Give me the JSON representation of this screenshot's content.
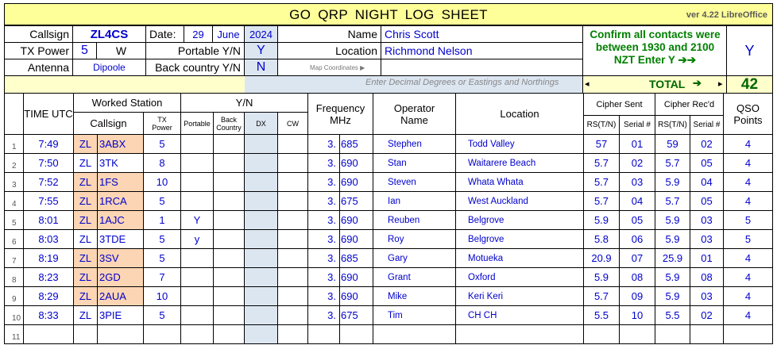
{
  "title": "GO  QRP  NIGHT  LOG  SHEET",
  "version": "ver 4.22 LibreOffice",
  "header": {
    "callsign_label": "Callsign",
    "callsign": "ZL4CS",
    "date_label": "Date:",
    "day": "29",
    "month": "June",
    "year": "2024",
    "name_label": "Name",
    "name": "Chris Scott",
    "tx_power_label": "TX Power",
    "tx_power": "5",
    "tx_power_unit": "W",
    "portable_label": "Portable Y/N",
    "portable": "Y",
    "location_label": "Location",
    "location": "Richmond Nelson",
    "antenna_label": "Antenna",
    "antenna": "Dipoole",
    "back_country_label": "Back country Y/N",
    "back_country": "N",
    "map_coords_label": "Map Coordinates ▶",
    "coords_hint": "Enter  Decimal Degrees or Eastings and Northings",
    "confirm_line1": "Confirm all contacts were",
    "confirm_line2": "between 1930 and 2100",
    "confirm_line3": "NZT    Enter   Y    ➔➔",
    "confirm_value": "Y",
    "total_label": "TOTAL",
    "total_arrow": "➔",
    "total_value": "42",
    "left_marker": "◂",
    "right_marker": "▸"
  },
  "columns": {
    "time_utc": "TIME UTC",
    "worked_station": "Worked Station",
    "callsign": "Callsign",
    "tx_power": "TX Power",
    "yn": "Y/N",
    "portable": "Portable",
    "back_country": "Back Country",
    "dx": "DX",
    "cw": "CW",
    "frequency": "Frequency MHz",
    "operator_name": "Operator Name",
    "location": "Location",
    "cipher_sent": "Cipher Sent",
    "cipher_recd": "Cipher Rec'd",
    "rs_tn": "RS(T/N)",
    "serial": "Serial #",
    "qso_points": "QSO Points"
  },
  "rows": [
    {
      "no": "1",
      "time": "7:49",
      "pre": "ZL",
      "suf": "3ABX",
      "orange": true,
      "power": "5",
      "portable": "",
      "back": "",
      "dx": "",
      "cw": "",
      "f1": "3.",
      "f2": "685",
      "op": "Stephen",
      "loc": "Todd Valley",
      "rs_s": "57",
      "ser_s": "01",
      "rs_r": "59",
      "ser_r": "02",
      "pts": "4"
    },
    {
      "no": "2",
      "time": "7:50",
      "pre": "ZL",
      "suf": "3TK",
      "orange": false,
      "power": "8",
      "portable": "",
      "back": "",
      "dx": "",
      "cw": "",
      "f1": "3.",
      "f2": "690",
      "op": "Stan",
      "loc": "Waitarere Beach",
      "rs_s": "5.7",
      "ser_s": "02",
      "rs_r": "5.7",
      "ser_r": "05",
      "pts": "4"
    },
    {
      "no": "3",
      "time": "7:52",
      "pre": "ZL",
      "suf": "1FS",
      "orange": true,
      "power": "10",
      "portable": "",
      "back": "",
      "dx": "",
      "cw": "",
      "f1": "3.",
      "f2": "690",
      "op": "Steven",
      "loc": "Whata Whata",
      "rs_s": "5.7",
      "ser_s": "03",
      "rs_r": "5.9",
      "ser_r": "04",
      "pts": "4"
    },
    {
      "no": "4",
      "time": "7:55",
      "pre": "ZL",
      "suf": "1RCA",
      "orange": true,
      "power": "5",
      "portable": "",
      "back": "",
      "dx": "",
      "cw": "",
      "f1": "3.",
      "f2": "675",
      "op": "Ian",
      "loc": "West Auckland",
      "rs_s": "5.7",
      "ser_s": "04",
      "rs_r": "5.7",
      "ser_r": "05",
      "pts": "4"
    },
    {
      "no": "5",
      "time": "8:01",
      "pre": "ZL",
      "suf": "1AJC",
      "orange": true,
      "power": "1",
      "portable": "Y",
      "back": "",
      "dx": "",
      "cw": "",
      "f1": "3.",
      "f2": "690",
      "op": "Reuben",
      "loc": "Belgrove",
      "rs_s": "5.9",
      "ser_s": "05",
      "rs_r": "5.9",
      "ser_r": "03",
      "pts": "5"
    },
    {
      "no": "6",
      "time": "8:03",
      "pre": "ZL",
      "suf": "3TDE",
      "orange": false,
      "power": "5",
      "portable": "y",
      "back": "",
      "dx": "",
      "cw": "",
      "f1": "3.",
      "f2": "690",
      "op": "Roy",
      "loc": "Belgrove",
      "rs_s": "5.8",
      "ser_s": "06",
      "rs_r": "5.9",
      "ser_r": "03",
      "pts": "5"
    },
    {
      "no": "7",
      "time": "8:19",
      "pre": "ZL",
      "suf": "3SV",
      "orange": true,
      "power": "5",
      "portable": "",
      "back": "",
      "dx": "",
      "cw": "",
      "f1": "3.",
      "f2": "685",
      "op": "Gary",
      "loc": "Motueka",
      "rs_s": "20.9",
      "ser_s": "07",
      "rs_r": "25.9",
      "ser_r": "01",
      "pts": "4"
    },
    {
      "no": "8",
      "time": "8:23",
      "pre": "ZL",
      "suf": "2GD",
      "orange": true,
      "power": "7",
      "portable": "",
      "back": "",
      "dx": "",
      "cw": "",
      "f1": "3.",
      "f2": "690",
      "op": "Grant",
      "loc": "Oxford",
      "rs_s": "5.9",
      "ser_s": "08",
      "rs_r": "5.9",
      "ser_r": "08",
      "pts": "4"
    },
    {
      "no": "9",
      "time": "8:29",
      "pre": "ZL",
      "suf": "2AUA",
      "orange": true,
      "power": "10",
      "portable": "",
      "back": "",
      "dx": "",
      "cw": "",
      "f1": "3.",
      "f2": "690",
      "op": "Mike",
      "loc": "Keri Keri",
      "rs_s": "5.7",
      "ser_s": "09",
      "rs_r": "5.9",
      "ser_r": "03",
      "pts": "4"
    },
    {
      "no": "10",
      "time": "8:33",
      "pre": "ZL",
      "suf": "3PIE",
      "orange": false,
      "power": "5",
      "portable": "",
      "back": "",
      "dx": "",
      "cw": "",
      "f1": "3.",
      "f2": "675",
      "op": "Tim",
      "loc": "CH CH",
      "rs_s": "5.5",
      "ser_s": "10",
      "rs_r": "5.5",
      "ser_r": "02",
      "pts": "4"
    },
    {
      "no": "11",
      "time": "",
      "pre": "",
      "suf": "",
      "orange": false,
      "power": "",
      "portable": "",
      "back": "",
      "dx": "",
      "cw": "",
      "f1": "",
      "f2": "",
      "op": "",
      "loc": "",
      "rs_s": "",
      "ser_s": "",
      "rs_r": "",
      "ser_r": "",
      "pts": ""
    }
  ]
}
